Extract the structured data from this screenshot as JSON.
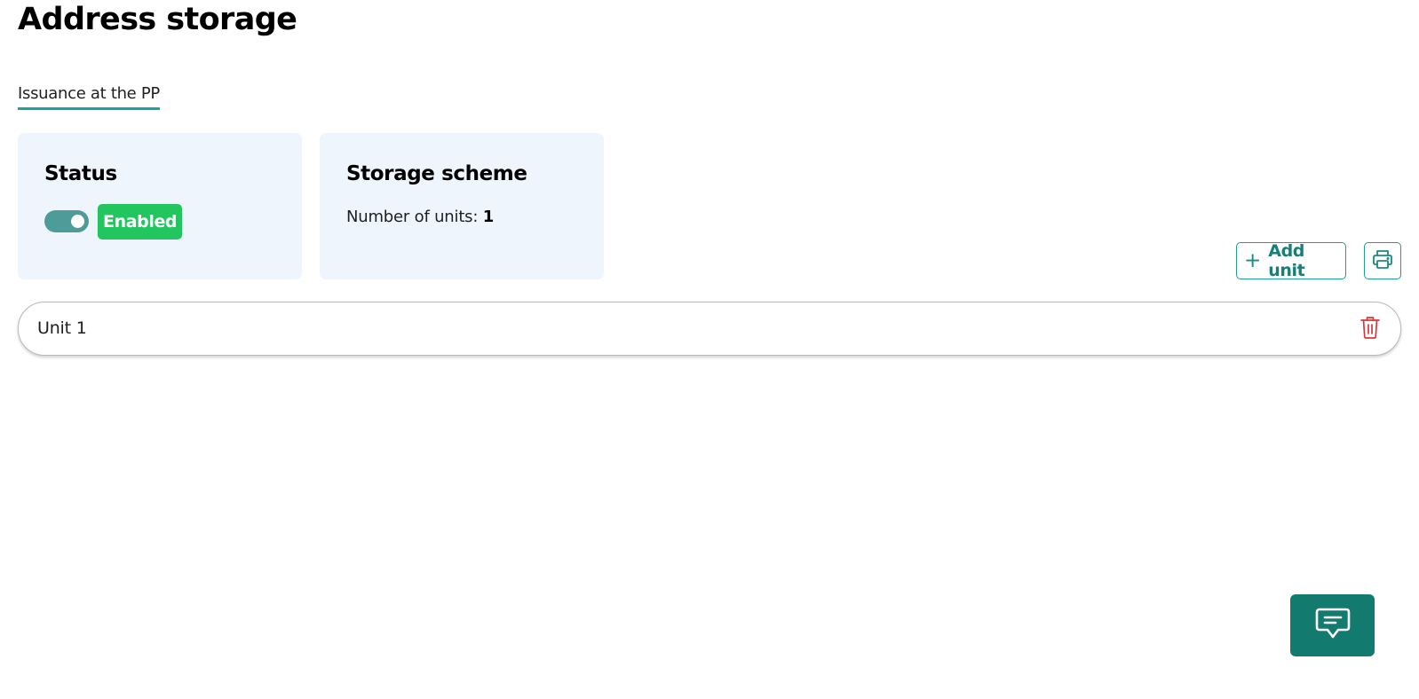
{
  "page": {
    "title": "Address storage"
  },
  "tabs": [
    {
      "label": "Issuance at the PP",
      "active": true
    }
  ],
  "status_card": {
    "title": "Status",
    "toggle_on": true,
    "badge_label": "Enabled"
  },
  "scheme_card": {
    "title": "Storage scheme",
    "units_label": "Number of units: ",
    "units_count": "1"
  },
  "toolbar": {
    "add_unit_label": "Add unit",
    "add_unit_icon": "plus-icon",
    "print_icon": "printer-icon"
  },
  "units": [
    {
      "label": "Unit 1",
      "action_icon": "trash-icon"
    }
  ],
  "chat": {
    "icon": "chat-bubble-icon"
  },
  "colors": {
    "accent": "#19a599",
    "accent_dark": "#137a70",
    "status_green": "#22c55e",
    "toggle_track": "#4e9c99",
    "card_background": "#eef5fd",
    "delete_red": "#d9373a"
  }
}
